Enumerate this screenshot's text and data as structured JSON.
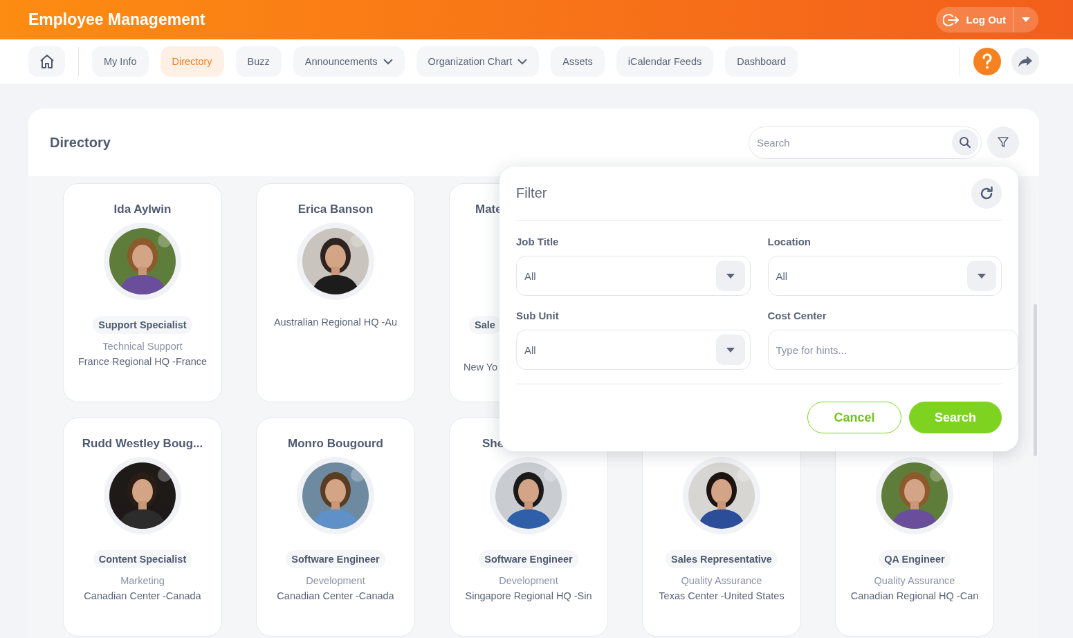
{
  "app_title": "Employee Management",
  "logout": {
    "label": "Log Out"
  },
  "nav": [
    {
      "label": "My Info",
      "selected": false,
      "dropdown": false
    },
    {
      "label": "Directory",
      "selected": true,
      "dropdown": false
    },
    {
      "label": "Buzz",
      "selected": false,
      "dropdown": false
    },
    {
      "label": "Announcements",
      "selected": false,
      "dropdown": true
    },
    {
      "label": "Organization Chart",
      "selected": false,
      "dropdown": true
    },
    {
      "label": "Assets",
      "selected": false,
      "dropdown": false
    },
    {
      "label": "iCalendar Feeds",
      "selected": false,
      "dropdown": false
    },
    {
      "label": "Dashboard",
      "selected": false,
      "dropdown": false
    }
  ],
  "directory": {
    "title": "Directory",
    "search": {
      "placeholder": "Search"
    }
  },
  "filter": {
    "title": "Filter",
    "fields": [
      {
        "kind": "select",
        "label": "Job Title",
        "value": "All"
      },
      {
        "kind": "select",
        "label": "Location",
        "value": "All"
      },
      {
        "kind": "select",
        "label": "Sub Unit",
        "value": "All"
      },
      {
        "kind": "text",
        "label": "Cost Center",
        "placeholder": "Type for hints..."
      }
    ],
    "buttons": [
      {
        "kind": "outline",
        "label": "Cancel"
      },
      {
        "kind": "solid",
        "label": "Search"
      }
    ]
  },
  "rows": [
    [
      {
        "name": "Ida Aylwin",
        "job_title": "Support Specialist",
        "sub_unit": "Technical Support",
        "location": "France Regional HQ -France"
      },
      {
        "name": "Erica Banson",
        "location": "Australian Regional HQ -Au"
      },
      {
        "name": "Mate",
        "job_title": "Sale",
        "location": "New Yo",
        "cut_off": true
      }
    ],
    [
      {
        "name": "Rudd Westley Boug...",
        "job_title": "Content Specialist",
        "sub_unit": "Marketing",
        "location": "Canadian Center -Canada"
      },
      {
        "name": "Monro Bougourd",
        "job_title": "Software Engineer",
        "sub_unit": "Development",
        "location": "Canadian Center -Canada"
      },
      {
        "name": "She",
        "job_title": "Software Engineer",
        "sub_unit": "Development",
        "location": "Singapore Regional HQ -Sin",
        "name_cut_off": true
      },
      {
        "job_title": "Sales Representative",
        "sub_unit": "Quality Assurance",
        "location": "Texas Center -United States"
      },
      {
        "job_title": "QA Engineer",
        "sub_unit": "Quality Assurance",
        "location": "Canadian Regional HQ -Can"
      }
    ]
  ]
}
